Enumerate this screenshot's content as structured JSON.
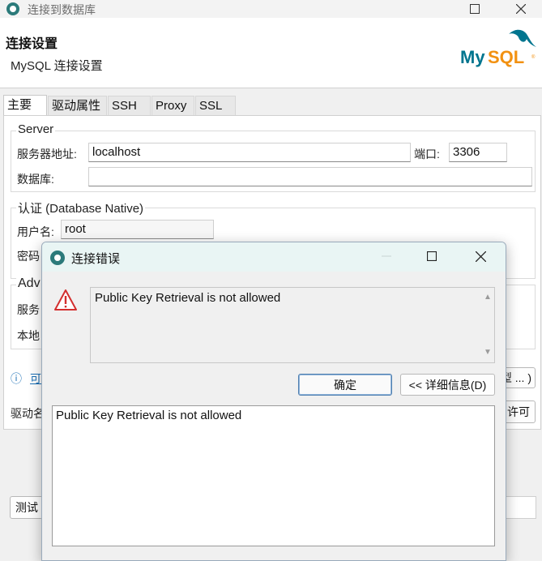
{
  "window": {
    "title": "连接到数据库",
    "max_icon": "maximize-icon",
    "close_icon": "close-icon"
  },
  "header": {
    "title": "连接设置",
    "subtitle": "MySQL 连接设置",
    "logo_text": "MySQL"
  },
  "tabs": [
    "主要",
    "驱动属性",
    "SSH",
    "Proxy",
    "SSL"
  ],
  "server_group": {
    "title": "Server",
    "host_label": "服务器地址:",
    "host_value": "localhost",
    "port_label": "端口:",
    "port_value": "3306",
    "database_label": "数据库:",
    "database_value": ""
  },
  "auth_group": {
    "title": "认证 (Database Native)",
    "user_label": "用户名:",
    "user_value": "root",
    "password_label": "密码"
  },
  "advanced_group": {
    "title_partial": "Adv",
    "row1_partial": "服务",
    "row2_partial": "本地"
  },
  "info_link_partial": "可",
  "type_button_partial": "型 ... )",
  "driver_label_partial": "驱动名",
  "license_button_partial": "许可",
  "test_button_partial": "测试",
  "dialog": {
    "title": "连接错误",
    "message": "Public Key Retrieval is not allowed",
    "ok_label": "确定",
    "details_label": "<< 详细信息(D)",
    "details_text": "Public Key Retrieval is not allowed"
  },
  "colors": {
    "accent": "#00758f",
    "logo_orange": "#f29111",
    "warning": "#d32f2f",
    "dialog_titlebar": "#e9f5f4"
  }
}
